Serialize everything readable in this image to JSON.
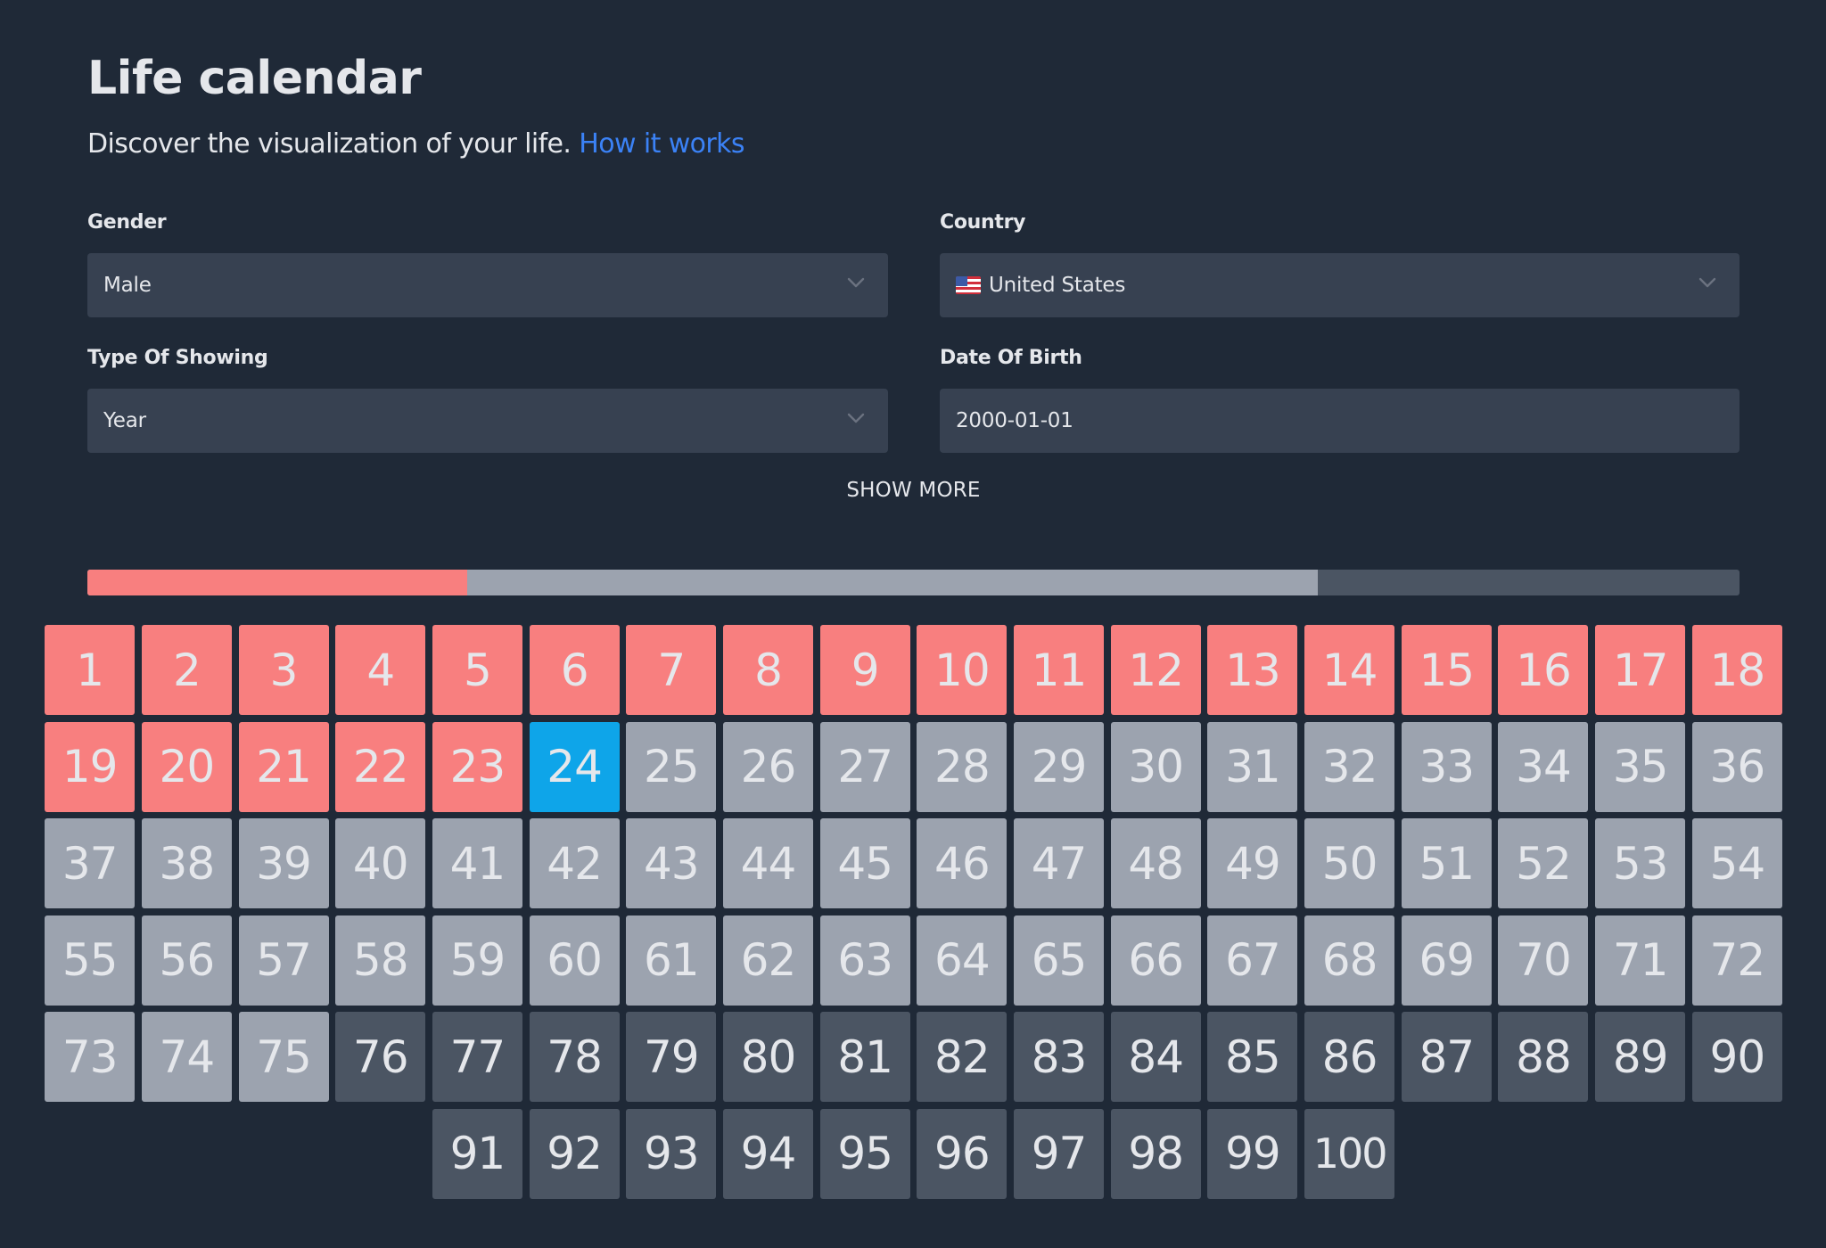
{
  "header": {
    "title": "Life calendar",
    "subtitle": "Discover the visualization of your life.",
    "how_it_works_link": "How it works"
  },
  "form": {
    "gender": {
      "label": "Gender",
      "value": "Male",
      "icon": "chevron-down-icon"
    },
    "country": {
      "label": "Country",
      "value": "United States",
      "flag": "us-flag-icon",
      "icon": "chevron-down-icon"
    },
    "type_of_showing": {
      "label": "Type Of Showing",
      "value": "Year",
      "icon": "chevron-down-icon"
    },
    "date_of_birth": {
      "label": "Date Of Birth",
      "value": "2000-01-01"
    }
  },
  "show_more_label": "SHOW MORE",
  "progress": {
    "lived_years": 23,
    "expected_years": 74.5,
    "max_years": 100
  },
  "calendar": {
    "total": 100,
    "current_year": 24,
    "lived_through": 23,
    "expected_through": 75
  },
  "colors": {
    "background": "#1f2937",
    "input_bg": "#374151",
    "lived": "#f87f7f",
    "current": "#0ea5e9",
    "expected": "#9ca3af",
    "beyond": "#4b5563",
    "link": "#3b82f6",
    "text": "#e5e7eb"
  }
}
